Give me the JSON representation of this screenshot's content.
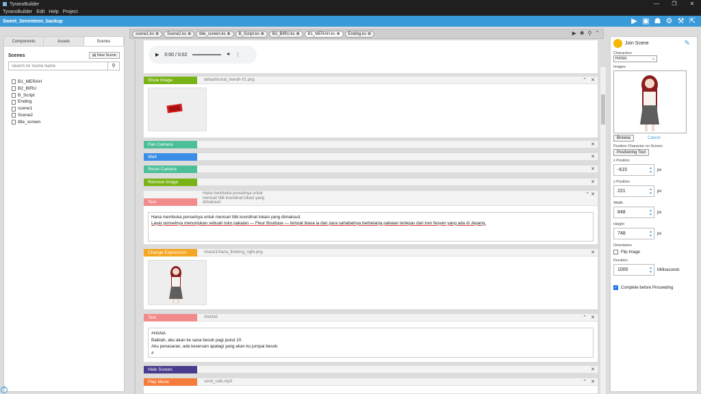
{
  "window": {
    "title": "TyranoBuilder",
    "controls": [
      "—",
      "❐",
      "✕"
    ]
  },
  "menu": [
    "TyranoBuilder",
    "Edit",
    "Help",
    "Project"
  ],
  "toolbar": {
    "project": "Sweet_Seventeen_backup"
  },
  "left": {
    "tabs": [
      "Components",
      "Assets",
      "Scenes"
    ],
    "scenes_title": "Scenes",
    "new_scene": "New Scene",
    "search_placeholder": "Search for Scene Name",
    "scenes": [
      "B1_MERAH",
      "B2_BIRU",
      "B_Script",
      "Ending",
      "scene1",
      "Scene2",
      "title_screen"
    ]
  },
  "tabs": [
    "scene1.ks",
    "Scene2.ks",
    "title_screen.ks",
    "B_Script.ks",
    "B2_BIRU.ks",
    "B1_MERAH.ks",
    "Ending.ks"
  ],
  "active_tab": "B1_MERAH.ks",
  "blocks": {
    "audio_time": "0:00 / 0:02",
    "show_image": {
      "label": "Show Image",
      "param": "default/surat_merah-01.png",
      "color": "#7ab317"
    },
    "pan_camera": {
      "label": "Pan Camera",
      "color": "#4cbf9a"
    },
    "wait": {
      "label": "Wait",
      "color": "#3a8ee6"
    },
    "reset_camera": {
      "label": "Reset Camera",
      "color": "#4cbf9a"
    },
    "remove_image": {
      "label": "Remove Image",
      "color": "#7ab317"
    },
    "text1": {
      "label": "Text",
      "param_line1": "Hana membuka ponselnya untuk",
      "param_line2": "mencari titik koordinat lokasi yang",
      "param_line3": "dimaksud.",
      "color": "#f28b8b",
      "line1": "Hana membuka ponselnya untuk mencari titik koordinat lokasi yang dimaksud.",
      "line2": "Layar ponselnya menunjukan sebuah toko pakaian — Fleur Boutique — tempat biasa ia dan para sahabatnya berbelanja pakaian terlepas dari tren fesyen yang ada di Jepang."
    },
    "change_expression": {
      "label": "Change Expression",
      "param": "chara/1/hana_thinking_right.png",
      "color": "#f5a623"
    },
    "text2": {
      "label": "Text",
      "param": "#HANA",
      "color": "#f28b8b",
      "line1": "#HANA",
      "line2": "Baiklah, aku akan ke sana besok pagi pukul 10.",
      "line3": "Aku penasaran, ada keseruan apalagi yang akan ku jumpai besok.",
      "line4": "#"
    },
    "hide_screen": {
      "label": "Hide Screen",
      "color": "#4a3b8f"
    },
    "play_music": {
      "label": "Play Music",
      "param": "sond_cafe.mp3",
      "color": "#f57c3a"
    }
  },
  "right": {
    "title": "Join Scene",
    "characters_label": "Characters",
    "character": "HANA",
    "images_label": "Images",
    "browse": "Browse",
    "cancel": "Cancel",
    "position_label": "Position Character on Screen",
    "positioning_tool": "Positioning Tool",
    "x_label": "x Position",
    "x_value": "-615",
    "x_unit": "px",
    "y_label": "y Position",
    "y_value": "221",
    "y_unit": "px",
    "w_label": "Width",
    "w_value": "848",
    "w_unit": "px",
    "h_label": "Height",
    "h_value": "748",
    "h_unit": "px",
    "orientation_label": "Orientation",
    "flip_label": "Flip Image",
    "duration_label": "Duration",
    "duration_value": "1000",
    "duration_unit": "Milliseconds",
    "complete_label": "Complete before Proceeding"
  }
}
